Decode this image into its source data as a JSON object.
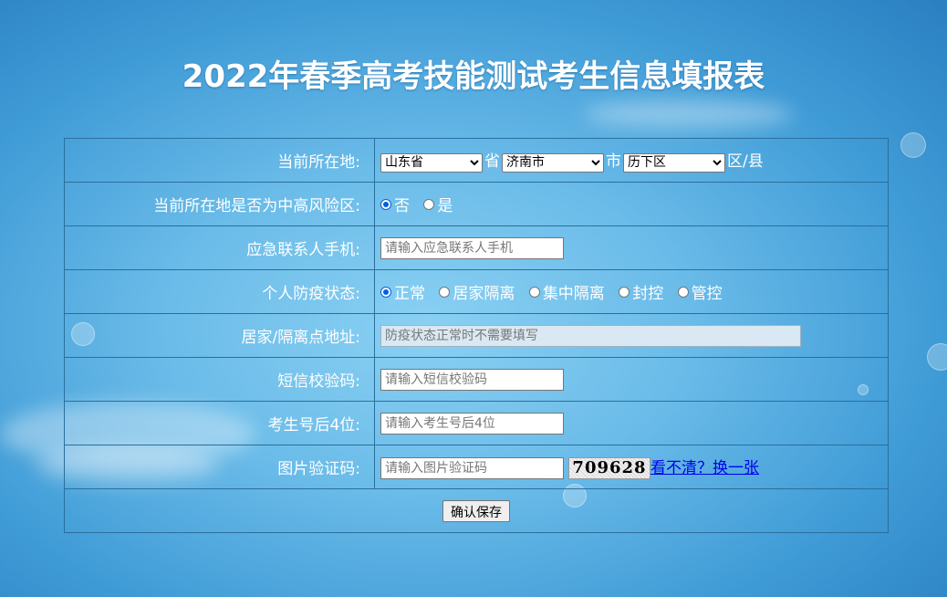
{
  "page": {
    "title": "2022年春季高考技能测试考生信息填报表"
  },
  "location": {
    "label": "当前所在地:",
    "province": "山东省",
    "province_suffix": "省",
    "city": "济南市",
    "city_suffix": "市",
    "district": "历下区",
    "district_suffix": "区/县"
  },
  "risk": {
    "label": "当前所在地是否为中高风险区:",
    "options": [
      "否",
      "是"
    ],
    "selected": "否"
  },
  "emergency": {
    "label": "应急联系人手机:",
    "placeholder": "请输入应急联系人手机"
  },
  "status": {
    "label": "个人防疫状态:",
    "options": [
      "正常",
      "居家隔离",
      "集中隔离",
      "封控",
      "管控"
    ],
    "selected": "正常"
  },
  "address": {
    "label": "居家/隔离点地址:",
    "placeholder": "防疫状态正常时不需要填写"
  },
  "sms": {
    "label": "短信校验码:",
    "placeholder": "请输入短信校验码"
  },
  "exam": {
    "label": "考生号后4位:",
    "placeholder": "请输入考生号后4位"
  },
  "captcha": {
    "label": "图片验证码:",
    "placeholder": "请输入图片验证码",
    "code": "709628",
    "refresh": "看不清？换一张"
  },
  "submit": {
    "label": "确认保存"
  }
}
